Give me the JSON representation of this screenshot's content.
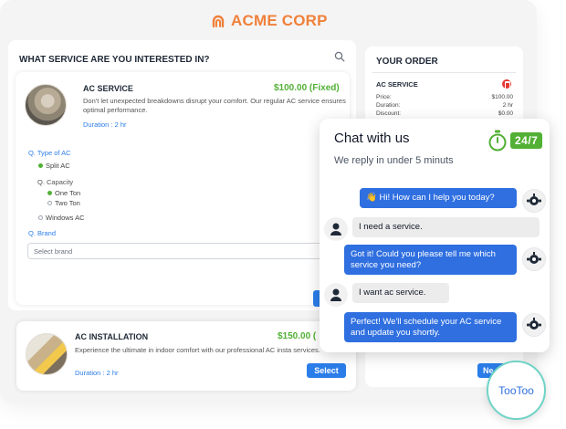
{
  "brand": {
    "name": "ACME CORP",
    "color": "#f0803a"
  },
  "services": {
    "heading": "WHAT SERVICE ARE YOU INTERESTED IN?",
    "search_icon": "search-icon",
    "ac_service": {
      "title": "AC SERVICE",
      "price": "$100.00 (Fixed)",
      "description": "Don't let unexpected breakdowns disrupt your comfort. Our regular AC service ensures optimal performance.",
      "duration": "Duration : 2 hr",
      "questions": {
        "type": {
          "label": "Q. Type of AC",
          "options": [
            "Split AC",
            "Windows AC"
          ]
        },
        "capacity": {
          "label": "Q. Capacity",
          "options": [
            "One Ton",
            "Two Ton"
          ]
        },
        "brand": {
          "label": "Q. Brand",
          "placeholder": "Select brand"
        }
      }
    },
    "ac_installation": {
      "title": "AC INSTALLATION",
      "price": "$150.00 (",
      "description": "Experience the ultimate in indoor comfort with our professional AC insta services.",
      "duration": "Duration : 2 hr",
      "select_label": "Select"
    }
  },
  "order": {
    "heading": "YOUR ORDER",
    "item": "AC SERVICE",
    "rows": [
      {
        "label": "Price:",
        "value": "$100.00"
      },
      {
        "label": "Duration:",
        "value": "2 hr"
      },
      {
        "label": "Discount:",
        "value": "$0.00"
      }
    ],
    "next_label": "Ne"
  },
  "chat": {
    "title": "Chat with us",
    "subtitle": "We reply in under 5 minuts",
    "badge": "24/7",
    "messages": [
      {
        "from": "bot",
        "text": "👋 Hi! How can I help you today?"
      },
      {
        "from": "user",
        "text": "I need a service."
      },
      {
        "from": "bot",
        "text": "Got it! Could you please tell me which service you need?"
      },
      {
        "from": "user",
        "text": "I want ac service."
      },
      {
        "from": "bot",
        "text": "Perfect! We'll schedule your AC service and update you shortly."
      }
    ]
  },
  "launcher": {
    "label": "TooToo"
  },
  "colors": {
    "accent_blue": "#2f6fe0",
    "price_green": "#52b035",
    "badge_green": "#52b035"
  }
}
